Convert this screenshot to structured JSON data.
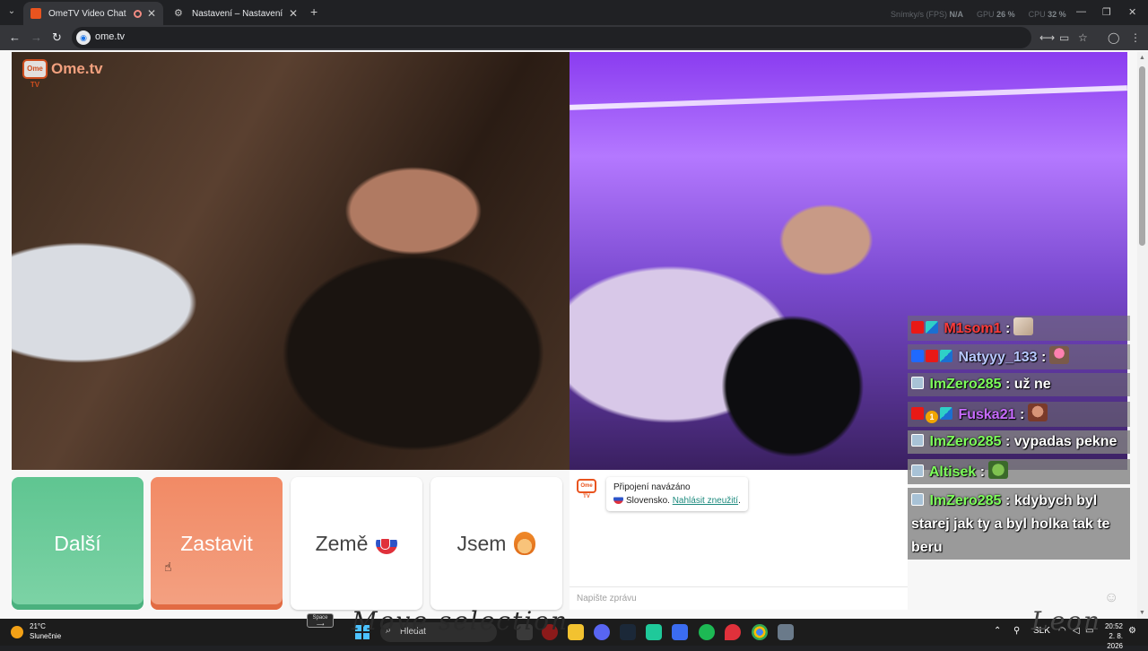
{
  "browser": {
    "tabs": [
      {
        "title": "OmeTV Video Chat — Ome",
        "active": true
      },
      {
        "title": "Nastavení – Nastavení webu",
        "active": false
      }
    ],
    "url": "ome.tv",
    "perf_overlay": {
      "fps_label": "Snímky/s (FPS)",
      "fps_value": "N/A",
      "gpu_label": "GPU",
      "gpu_value": "26 %",
      "cpu_label": "CPU",
      "cpu_value": "32 %"
    }
  },
  "ometv": {
    "logo_text": "Ome.tv",
    "logo_box": "Ome TV",
    "buttons": {
      "next": "Další",
      "stop": "Zastavit",
      "country": "Země",
      "gender": "Jsem"
    },
    "notice": {
      "line1": "Připojení navázáno",
      "line2_country": "Slovensko.",
      "report_link": "Nahlásit zneužití",
      "period": "."
    },
    "message_placeholder": "Napište zprávu"
  },
  "stream_chat": [
    {
      "user": "M1som1",
      "text": ":",
      "color": "red"
    },
    {
      "user": "Natyyy_133",
      "text": ":",
      "color": "blue"
    },
    {
      "user": "ImZero285",
      "text": ": už ne",
      "color": "green"
    },
    {
      "user": "Fuska21",
      "text": ":",
      "color": "purple"
    },
    {
      "user": "ImZero285",
      "text": ": vypadas pekne",
      "color": "green"
    },
    {
      "user": "Altisek",
      "text": ":",
      "color": "green"
    },
    {
      "user": "ImZero285",
      "text": ": kdybych byl starej jak ty a byl holka tak te beru",
      "color": "green"
    }
  ],
  "overlay": {
    "left_text": "Move selection",
    "right_text": "Leon",
    "space_key": "Space"
  },
  "taskbar": {
    "weather_temp": "21°C",
    "weather_desc": "Slunečnie",
    "search_placeholder": "Hledat",
    "language": "SLK",
    "time": "20:52",
    "date": "2. 8. 2026"
  },
  "colors": {
    "next": "#5fc591",
    "stop": "#f28a65",
    "brand": "#e9541f",
    "link": "#1d8a7e"
  }
}
